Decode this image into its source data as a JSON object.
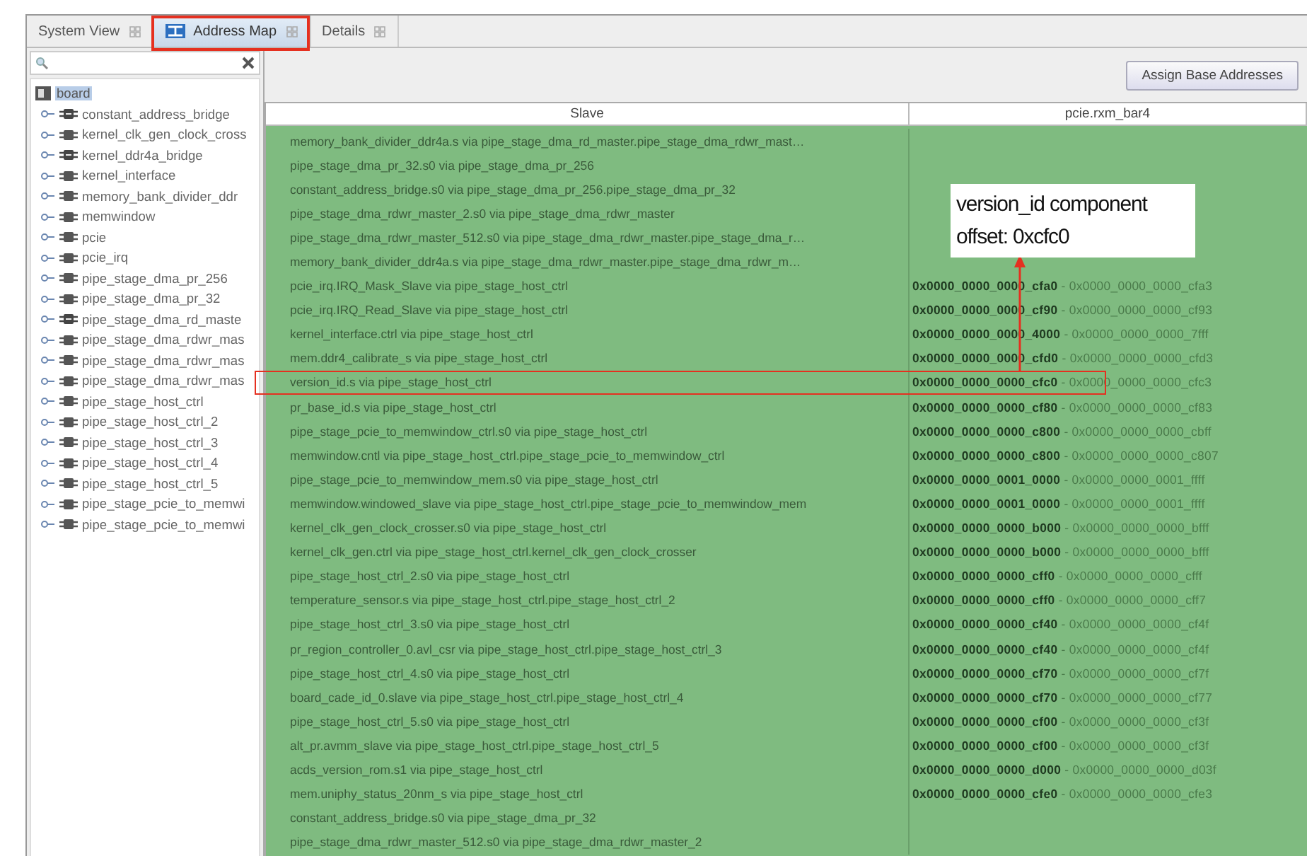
{
  "tabs": [
    {
      "label": "System View",
      "selected": false,
      "highlighted": false
    },
    {
      "label": "Address Map",
      "selected": true,
      "highlighted": true
    },
    {
      "label": "Details",
      "selected": false,
      "highlighted": false
    }
  ],
  "tree": {
    "root": {
      "label": "board",
      "selected": true,
      "children": [
        {
          "label": "constant_address_bridge",
          "kind": "bridge"
        },
        {
          "label": "kernel_clk_gen_clock_cross",
          "kind": "component"
        },
        {
          "label": "kernel_ddr4a_bridge",
          "kind": "bridge"
        },
        {
          "label": "kernel_interface",
          "kind": "component"
        },
        {
          "label": "memory_bank_divider_ddr",
          "kind": "component"
        },
        {
          "label": "memwindow",
          "kind": "component"
        },
        {
          "label": "pcie",
          "kind": "component"
        },
        {
          "label": "pcie_irq",
          "kind": "component"
        },
        {
          "label": "pipe_stage_dma_pr_256",
          "kind": "component"
        },
        {
          "label": "pipe_stage_dma_pr_32",
          "kind": "component"
        },
        {
          "label": "pipe_stage_dma_rd_maste",
          "kind": "bridge"
        },
        {
          "label": "pipe_stage_dma_rdwr_mas",
          "kind": "component"
        },
        {
          "label": "pipe_stage_dma_rdwr_mas",
          "kind": "component"
        },
        {
          "label": "pipe_stage_dma_rdwr_mas",
          "kind": "component"
        },
        {
          "label": "pipe_stage_host_ctrl",
          "kind": "component"
        },
        {
          "label": "pipe_stage_host_ctrl_2",
          "kind": "component"
        },
        {
          "label": "pipe_stage_host_ctrl_3",
          "kind": "component"
        },
        {
          "label": "pipe_stage_host_ctrl_4",
          "kind": "component"
        },
        {
          "label": "pipe_stage_host_ctrl_5",
          "kind": "component"
        },
        {
          "label": "pipe_stage_pcie_to_memwi",
          "kind": "component"
        },
        {
          "label": "pipe_stage_pcie_to_memwi",
          "kind": "component"
        }
      ]
    }
  },
  "assign_button": "Assign Base Addresses",
  "table": {
    "columns": [
      "Slave",
      "pcie.rxm_bar4"
    ],
    "rows": [
      {
        "slave": "memory_bank_divider_ddr4a.s via pipe_stage_dma_rd_master.pipe_stage_dma_rdwr_mast…",
        "highlighted": false
      },
      {
        "slave": "pipe_stage_dma_pr_32.s0 via pipe_stage_dma_pr_256",
        "highlighted": false
      },
      {
        "slave": "constant_address_bridge.s0 via pipe_stage_dma_pr_256.pipe_stage_dma_pr_32",
        "highlighted": false
      },
      {
        "slave": "pipe_stage_dma_rdwr_master_2.s0 via pipe_stage_dma_rdwr_master",
        "highlighted": false
      },
      {
        "slave": "pipe_stage_dma_rdwr_master_512.s0 via pipe_stage_dma_rdwr_master.pipe_stage_dma_r…",
        "highlighted": false
      },
      {
        "slave": "memory_bank_divider_ddr4a.s via pipe_stage_dma_rdwr_master.pipe_stage_dma_rdwr_m…",
        "highlighted": false
      },
      {
        "slave": "pcie_irq.IRQ_Mask_Slave via pipe_stage_host_ctrl",
        "range": "**0x0000_0000_0000_cfa0** - 0x0000_0000_0000_cfa3",
        "highlighted": false
      },
      {
        "slave": "pcie_irq.IRQ_Read_Slave via pipe_stage_host_ctrl",
        "range": "**0x0000_0000_0000_cf90** - 0x0000_0000_0000_cf93",
        "highlighted": false
      },
      {
        "slave": "kernel_interface.ctrl via pipe_stage_host_ctrl",
        "range": "**0x0000_0000_0000_4000** - 0x0000_0000_0000_7fff",
        "highlighted": false
      },
      {
        "slave": "mem.ddr4_calibrate_s via pipe_stage_host_ctrl",
        "range": "**0x0000_0000_0000_cfd0** - 0x0000_0000_0000_cfd3",
        "highlighted": false
      },
      {
        "slave": "version_id.s via pipe_stage_host_ctrl",
        "range": "**0x0000_0000_0000_cfc0** - 0x0000_0000_0000_cfc3",
        "highlighted": true
      },
      {
        "slave": "pr_base_id.s via pipe_stage_host_ctrl",
        "range": "**0x0000_0000_0000_cf80** - 0x0000_0000_0000_cf83",
        "highlighted": false
      },
      {
        "slave": "pipe_stage_pcie_to_memwindow_ctrl.s0 via pipe_stage_host_ctrl",
        "range": "**0x0000_0000_0000_c800** - 0x0000_0000_0000_cbff",
        "highlighted": false
      },
      {
        "slave": "memwindow.cntl via pipe_stage_host_ctrl.pipe_stage_pcie_to_memwindow_ctrl",
        "range": "**0x0000_0000_0000_c800** - 0x0000_0000_0000_c807",
        "highlighted": false
      },
      {
        "slave": "pipe_stage_pcie_to_memwindow_mem.s0 via pipe_stage_host_ctrl",
        "range": "**0x0000_0000_0001_0000** - 0x0000_0000_0001_ffff",
        "highlighted": false
      },
      {
        "slave": "memwindow.windowed_slave via pipe_stage_host_ctrl.pipe_stage_pcie_to_memwindow_mem",
        "range": "**0x0000_0000_0001_0000** - 0x0000_0000_0001_ffff",
        "highlighted": false
      },
      {
        "slave": "kernel_clk_gen_clock_crosser.s0 via pipe_stage_host_ctrl",
        "range": "**0x0000_0000_0000_b000** - 0x0000_0000_0000_bfff",
        "highlighted": false
      },
      {
        "slave": "kernel_clk_gen.ctrl via pipe_stage_host_ctrl.kernel_clk_gen_clock_crosser",
        "range": "**0x0000_0000_0000_b000** - 0x0000_0000_0000_bfff",
        "highlighted": false
      },
      {
        "slave": "pipe_stage_host_ctrl_2.s0 via pipe_stage_host_ctrl",
        "range": "**0x0000_0000_0000_cff0** - 0x0000_0000_0000_cfff",
        "highlighted": false
      },
      {
        "slave": "temperature_sensor.s via pipe_stage_host_ctrl.pipe_stage_host_ctrl_2",
        "range": "**0x0000_0000_0000_cff0** - 0x0000_0000_0000_cff7",
        "highlighted": false
      },
      {
        "slave": "pipe_stage_host_ctrl_3.s0 via pipe_stage_host_ctrl",
        "range": "**0x0000_0000_0000_cf40** - 0x0000_0000_0000_cf4f",
        "highlighted": false
      },
      {
        "slave": "pr_region_controller_0.avl_csr via pipe_stage_host_ctrl.pipe_stage_host_ctrl_3",
        "range": "**0x0000_0000_0000_cf40** - 0x0000_0000_0000_cf4f",
        "highlighted": false
      },
      {
        "slave": "pipe_stage_host_ctrl_4.s0 via pipe_stage_host_ctrl",
        "range": "**0x0000_0000_0000_cf70** - 0x0000_0000_0000_cf7f",
        "highlighted": false
      },
      {
        "slave": "board_cade_id_0.slave via pipe_stage_host_ctrl.pipe_stage_host_ctrl_4",
        "range": "**0x0000_0000_0000_cf70** - 0x0000_0000_0000_cf77",
        "highlighted": false
      },
      {
        "slave": "pipe_stage_host_ctrl_5.s0 via pipe_stage_host_ctrl",
        "range": "**0x0000_0000_0000_cf00** - 0x0000_0000_0000_cf3f",
        "highlighted": false
      },
      {
        "slave": "alt_pr.avmm_slave via pipe_stage_host_ctrl.pipe_stage_host_ctrl_5",
        "range": "**0x0000_0000_0000_cf00** - 0x0000_0000_0000_cf3f",
        "highlighted": false
      },
      {
        "slave": "acds_version_rom.s1 via pipe_stage_host_ctrl",
        "range": "**0x0000_0000_0000_d000** - 0x0000_0000_0000_d03f",
        "highlighted": false
      },
      {
        "slave": "mem.uniphy_status_20nm_s via pipe_stage_host_ctrl",
        "range": "**0x0000_0000_0000_cfe0** - 0x0000_0000_0000_cfe3",
        "highlighted": false
      },
      {
        "slave": "constant_address_bridge.s0 via pipe_stage_dma_pr_32",
        "highlighted": false
      },
      {
        "slave": "pipe_stage_dma_rdwr_master_512.s0 via pipe_stage_dma_rdwr_master_2",
        "highlighted": false
      }
    ]
  },
  "callout": {
    "lines": [
      "version_id component",
      "offset: 0xcfc0"
    ]
  }
}
